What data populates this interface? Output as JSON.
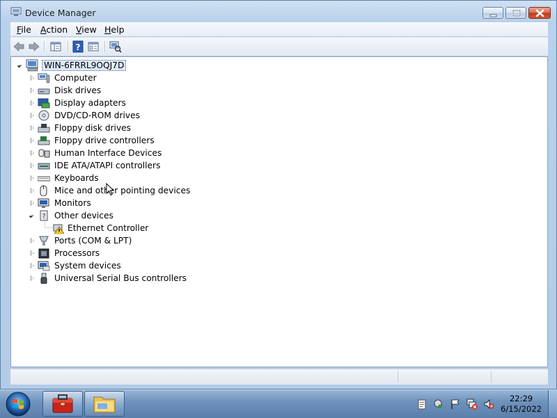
{
  "window": {
    "title": "Device Manager"
  },
  "menubar": {
    "file": {
      "accel": "F",
      "rest": "ile"
    },
    "action": {
      "accel": "A",
      "rest": "ction"
    },
    "view": {
      "accel": "V",
      "rest": "iew"
    },
    "help": {
      "accel": "H",
      "rest": "elp"
    }
  },
  "toolbar": {
    "icons": [
      "back-arrow-icon",
      "forward-arrow-icon",
      "console-tree-icon",
      "help-icon",
      "properties-icon",
      "scan-hardware-icon"
    ]
  },
  "tree": {
    "root": "WIN-6FRRL9OQJ7D",
    "items": [
      {
        "label": "Computer",
        "icon": "computer-icon",
        "expanded": false
      },
      {
        "label": "Disk drives",
        "icon": "disk-drive-icon",
        "expanded": false
      },
      {
        "label": "Display adapters",
        "icon": "display-adapter-icon",
        "expanded": false
      },
      {
        "label": "DVD/CD-ROM drives",
        "icon": "dvd-drive-icon",
        "expanded": false
      },
      {
        "label": "Floppy disk drives",
        "icon": "floppy-drive-icon",
        "expanded": false
      },
      {
        "label": "Floppy drive controllers",
        "icon": "floppy-controller-icon",
        "expanded": false
      },
      {
        "label": "Human Interface Devices",
        "icon": "hid-icon",
        "expanded": false
      },
      {
        "label": "IDE ATA/ATAPI controllers",
        "icon": "ide-controller-icon",
        "expanded": false
      },
      {
        "label": "Keyboards",
        "icon": "keyboard-icon",
        "expanded": false
      },
      {
        "label": "Mice and other pointing devices",
        "icon": "mouse-icon",
        "expanded": false
      },
      {
        "label": "Monitors",
        "icon": "monitor-icon",
        "expanded": false
      },
      {
        "label": "Other devices",
        "icon": "unknown-device-icon",
        "expanded": true,
        "children": [
          {
            "label": "Ethernet Controller",
            "icon": "warning-device-icon"
          }
        ]
      },
      {
        "label": "Ports (COM & LPT)",
        "icon": "port-icon",
        "expanded": false
      },
      {
        "label": "Processors",
        "icon": "processor-icon",
        "expanded": false
      },
      {
        "label": "System devices",
        "icon": "system-device-icon",
        "expanded": false
      },
      {
        "label": "Universal Serial Bus controllers",
        "icon": "usb-icon",
        "expanded": false
      }
    ]
  },
  "taskbar": {
    "time": "22:29",
    "date": "6/15/2022",
    "tray_icons": [
      "clipboard-icon",
      "security-shield-icon",
      "action-center-flag-icon",
      "network-error-icon",
      "volume-muted-icon"
    ]
  },
  "colors": {
    "title_bg": "#cfe0f3",
    "close_button": "#c23a1a",
    "taskbar": "#6f93bd",
    "selection": "#dce8f7"
  }
}
